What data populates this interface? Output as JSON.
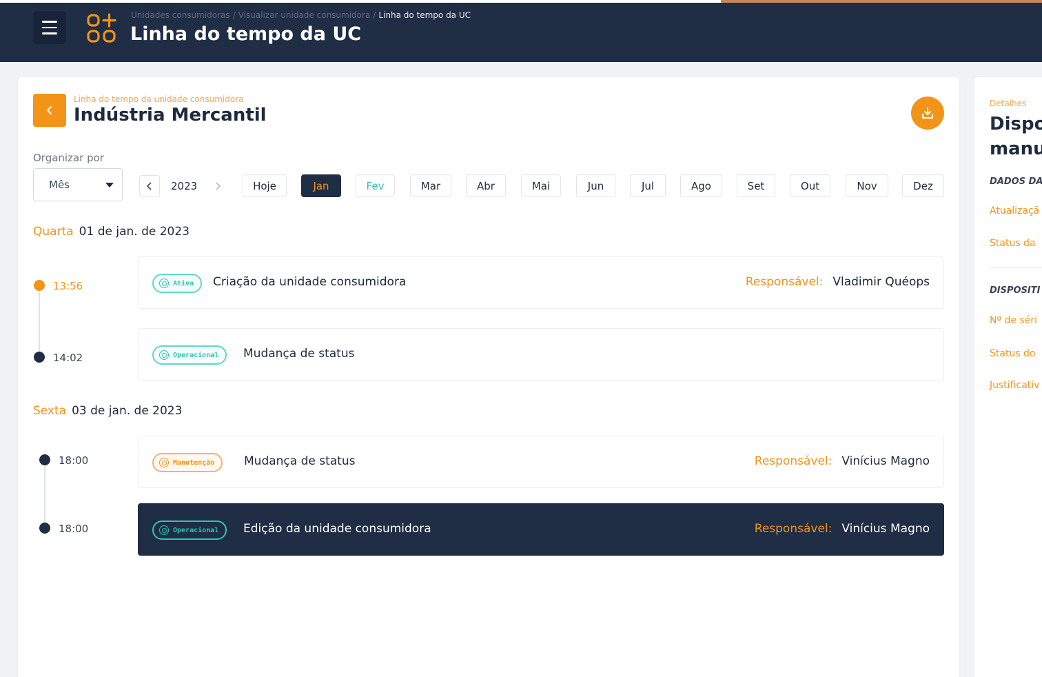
{
  "header": {
    "breadcrumb": [
      "Unidades consumidoras",
      "Visualizar unidade consumidora",
      "Linha do tempo da UC"
    ],
    "title": "Linha do tempo da UC"
  },
  "card": {
    "subtitle": "Linha do tempo da unidade consumidora",
    "title": "Indústria Mercantil"
  },
  "filters": {
    "organize_label": "Organizar por",
    "organize_value": "Mês",
    "year": "2023",
    "today_label": "Hoje",
    "months": [
      "Jan",
      "Fev",
      "Mar",
      "Abr",
      "Mai",
      "Jun",
      "Jul",
      "Ago",
      "Set",
      "Out",
      "Nov",
      "Dez"
    ],
    "selected_month": "Jan"
  },
  "days": [
    {
      "weekday": "Quarta",
      "date": "01 de jan. de 2023",
      "events": [
        {
          "time": "13:56",
          "badge": "Ativa",
          "title": "Criação da unidade consumidora",
          "resp_label": "Responsável:",
          "resp_name": "Vladimir Quéops"
        },
        {
          "time": "14:02",
          "badge": "Operacional",
          "title": "Mudança de status",
          "resp_label": "",
          "resp_name": ""
        }
      ]
    },
    {
      "weekday": "Sexta",
      "date": "03 de jan. de 2023",
      "events": [
        {
          "time": "18:00",
          "badge": "Manutenção",
          "title": "Mudança de status",
          "resp_label": "Responsável:",
          "resp_name": "Vinícius Magno"
        },
        {
          "time": "18:00",
          "badge": "Operacional",
          "title": "Edição da unidade consumidora",
          "resp_label": "Responsável:",
          "resp_name": "Vinícius Magno"
        }
      ]
    }
  ],
  "side_panel": {
    "small_label": "Detalhes",
    "title_line1": "Dispos",
    "title_line2": "manu",
    "section1": "DADOS DA",
    "field1": "Atualizaçã",
    "field2": "Status da",
    "section2": "DISPOSITI",
    "field3": "Nº de séri",
    "field4": "Status do",
    "field5": "Justificativ"
  },
  "colors": {
    "navy": "#1f2d45",
    "orange": "#f39318",
    "teal": "#2cc6b5"
  }
}
